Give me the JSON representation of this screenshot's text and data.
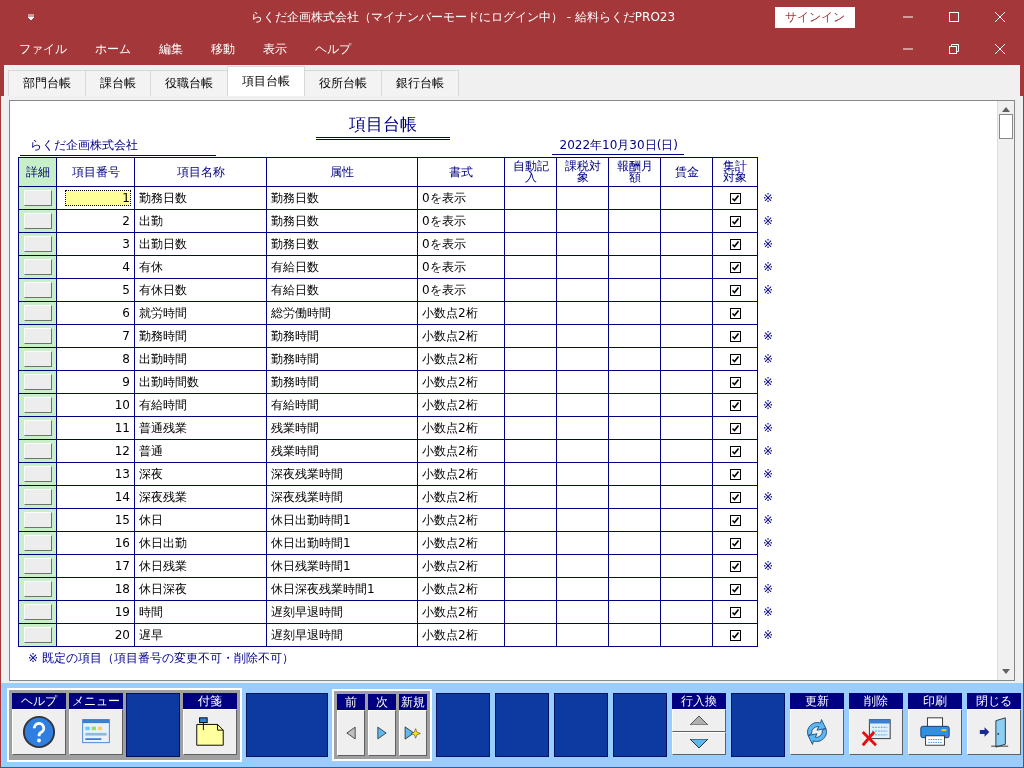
{
  "window": {
    "title": "らくだ企画株式会社（マイナンバーモードにログイン中） - 給料らくだPRO23",
    "signin_button": "サインイン"
  },
  "menu": [
    "ファイル",
    "ホーム",
    "編集",
    "移動",
    "表示",
    "ヘルプ"
  ],
  "tabs": [
    {
      "label": "部門台帳",
      "selected": false
    },
    {
      "label": "課台帳",
      "selected": false
    },
    {
      "label": "役職台帳",
      "selected": false
    },
    {
      "label": "項目台帳",
      "selected": true
    },
    {
      "label": "役所台帳",
      "selected": false
    },
    {
      "label": "銀行台帳",
      "selected": false
    }
  ],
  "report": {
    "title": "項目台帳",
    "company": "らくだ企画株式会社",
    "date": "2022年10月30日(日)"
  },
  "table": {
    "columns": [
      "詳細",
      "項目番号",
      "項目名称",
      "属性",
      "書式",
      "自動記入",
      "課税対象",
      "報酬月額",
      "賃金",
      "集計対象"
    ],
    "rows": [
      {
        "number": "1",
        "name": "勤務日数",
        "attribute": "勤務日数",
        "format": "0を表示",
        "selected": true,
        "checked": true,
        "note": "※"
      },
      {
        "number": "2",
        "name": "出勤",
        "attribute": "勤務日数",
        "format": "0を表示",
        "selected": false,
        "checked": true,
        "note": "※"
      },
      {
        "number": "3",
        "name": "出勤日数",
        "attribute": "勤務日数",
        "format": "0を表示",
        "selected": false,
        "checked": true,
        "note": "※"
      },
      {
        "number": "4",
        "name": "有休",
        "attribute": "有給日数",
        "format": "0を表示",
        "selected": false,
        "checked": true,
        "note": "※"
      },
      {
        "number": "5",
        "name": "有休日数",
        "attribute": "有給日数",
        "format": "0を表示",
        "selected": false,
        "checked": true,
        "note": "※"
      },
      {
        "number": "6",
        "name": "就労時間",
        "attribute": "総労働時間",
        "format": "小数点2桁",
        "selected": false,
        "checked": true
      },
      {
        "number": "7",
        "name": "勤務時間",
        "attribute": "勤務時間",
        "format": "小数点2桁",
        "selected": false,
        "checked": true,
        "note": "※"
      },
      {
        "number": "8",
        "name": "出勤時間",
        "attribute": "勤務時間",
        "format": "小数点2桁",
        "selected": false,
        "checked": true,
        "note": "※"
      },
      {
        "number": "9",
        "name": "出勤時間数",
        "attribute": "勤務時間",
        "format": "小数点2桁",
        "selected": false,
        "checked": true,
        "note": "※"
      },
      {
        "number": "10",
        "name": "有給時間",
        "attribute": "有給時間",
        "format": "小数点2桁",
        "selected": false,
        "checked": true,
        "note": "※"
      },
      {
        "number": "11",
        "name": "普通残業",
        "attribute": "残業時間",
        "format": "小数点2桁",
        "selected": false,
        "checked": true,
        "note": "※"
      },
      {
        "number": "12",
        "name": "普通",
        "attribute": "残業時間",
        "format": "小数点2桁",
        "selected": false,
        "checked": true,
        "note": "※"
      },
      {
        "number": "13",
        "name": "深夜",
        "attribute": "深夜残業時間",
        "format": "小数点2桁",
        "selected": false,
        "checked": true,
        "note": "※"
      },
      {
        "number": "14",
        "name": "深夜残業",
        "attribute": "深夜残業時間",
        "format": "小数点2桁",
        "selected": false,
        "checked": true,
        "note": "※"
      },
      {
        "number": "15",
        "name": "休日",
        "attribute": "休日出勤時間1",
        "format": "小数点2桁",
        "selected": false,
        "checked": true,
        "note": "※"
      },
      {
        "number": "16",
        "name": "休日出勤",
        "attribute": "休日出勤時間1",
        "format": "小数点2桁",
        "selected": false,
        "checked": true,
        "note": "※"
      },
      {
        "number": "17",
        "name": "休日残業",
        "attribute": "休日残業時間1",
        "format": "小数点2桁",
        "selected": false,
        "checked": true,
        "note": "※"
      },
      {
        "number": "18",
        "name": "休日深夜",
        "attribute": "休日深夜残業時間1",
        "format": "小数点2桁",
        "selected": false,
        "checked": true,
        "note": "※"
      },
      {
        "number": "19",
        "name": "時間",
        "attribute": "遅刻早退時間",
        "format": "小数点2桁",
        "selected": false,
        "checked": true,
        "note": "※"
      },
      {
        "number": "20",
        "name": "遅早",
        "attribute": "遅刻早退時間",
        "format": "小数点2桁",
        "selected": false,
        "checked": true,
        "note": "※"
      }
    ]
  },
  "footnote": "※ 既定の項目（項目番号の変更不可・削除不可）",
  "toolbar": [
    {
      "framed": true,
      "items": [
        {
          "kind": "help",
          "label": "ヘルプ"
        },
        {
          "kind": "menu",
          "label": "メニュー"
        },
        {
          "kind": "blank"
        },
        {
          "kind": "note",
          "label": "付箋"
        }
      ]
    },
    {
      "framed": false,
      "items": [
        {
          "kind": "wide"
        }
      ]
    },
    {
      "framed": true,
      "items": [
        {
          "kind": "prev",
          "label": "前"
        },
        {
          "kind": "next",
          "label": "次"
        },
        {
          "kind": "new",
          "label": "新規"
        }
      ]
    },
    {
      "framed": false,
      "items": [
        {
          "kind": "blank"
        },
        {
          "kind": "blank"
        },
        {
          "kind": "blank"
        },
        {
          "kind": "blank"
        },
        {
          "kind": "swap",
          "label": "行入換"
        },
        {
          "kind": "blank"
        },
        {
          "kind": "refresh",
          "label": "更新"
        },
        {
          "kind": "delete",
          "label": "削除"
        },
        {
          "kind": "print",
          "label": "印刷"
        },
        {
          "kind": "close",
          "label": "閉じる"
        }
      ]
    }
  ]
}
